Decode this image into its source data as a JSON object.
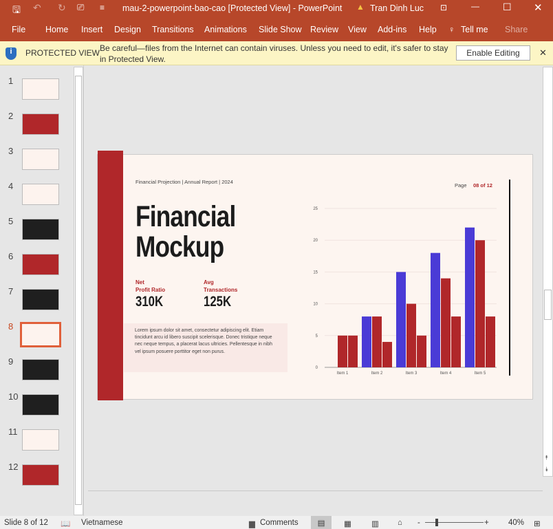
{
  "window": {
    "title": "mau-2-powerpoint-bao-cao [Protected View]  -  PowerPoint",
    "user": "Tran Dinh Luc"
  },
  "ribbon": {
    "tabs": [
      "File",
      "Home",
      "Insert",
      "Design",
      "Transitions",
      "Animations",
      "Slide Show",
      "Review",
      "View",
      "Add-ins",
      "Help",
      "Tell me",
      "Share"
    ]
  },
  "protected": {
    "label": "PROTECTED VIEW",
    "message_line1": "Be careful—files from the Internet can contain viruses. Unless you need to edit, it's safer to stay",
    "message_line2": "in Protected View.",
    "button": "Enable Editing"
  },
  "thumbnails": {
    "numbers": [
      "1",
      "2",
      "3",
      "4",
      "5",
      "6",
      "7",
      "8",
      "9",
      "10",
      "11",
      "12"
    ],
    "selected": 8
  },
  "slide": {
    "header": "Financial Projection | Annual Report | 2024",
    "page_label": "Page",
    "page_value": "08 of 12",
    "title_line1": "Financial",
    "title_line2": "Mockup",
    "stat1": {
      "label1": "Net",
      "label2": "Profit Ratio",
      "value": "310K"
    },
    "stat2": {
      "label1": "Avg",
      "label2": "Transactions",
      "value": "125K"
    },
    "body": "Lorem ipsum dolor sit amet, consectetur adipiscing elit. Etiam tincidunt arcu id libero suscipit scelerisque. Donec tristique neque nec neque tempus, a placerat lacus ultricies. Pellentesque in nibh vel ipsum posuere porttitor eget non purus.",
    "accent": "#b0272a"
  },
  "chart_data": {
    "type": "bar",
    "categories": [
      "Item 1",
      "Item 2",
      "Item 3",
      "Item 4",
      "Item 5"
    ],
    "series": [
      {
        "values": [
          0,
          8,
          15,
          18,
          22
        ],
        "color": "#4a3bd6"
      },
      {
        "values": [
          5,
          8,
          10,
          14,
          20
        ],
        "color": "#b0272a"
      },
      {
        "values": [
          5,
          4,
          5,
          8,
          8
        ],
        "color": "#b0272a"
      }
    ],
    "yticks": [
      "0",
      "5",
      "10",
      "15",
      "20",
      "25"
    ],
    "ylim": [
      0,
      25
    ],
    "grid": true
  },
  "status": {
    "slide": "Slide 8 of 12",
    "language": "Vietnamese",
    "comments": "Comments",
    "zoom": "40%"
  }
}
